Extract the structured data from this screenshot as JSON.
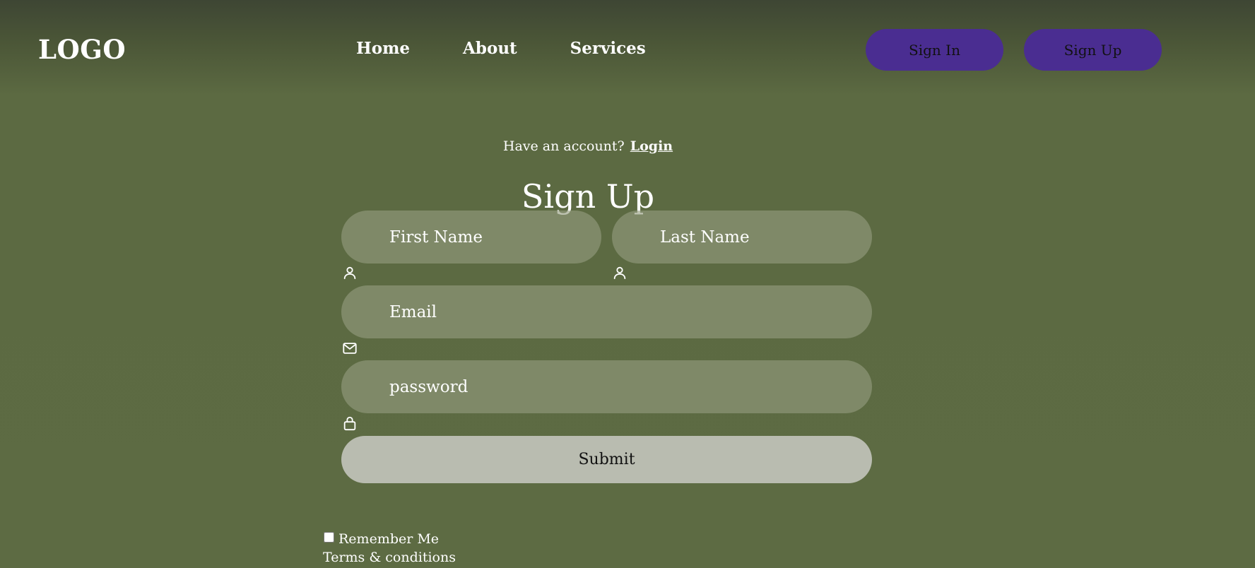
{
  "header": {
    "logo": "LOGO",
    "nav": [
      {
        "label": "Home"
      },
      {
        "label": "About"
      },
      {
        "label": "Services"
      }
    ],
    "sign_in_label": "Sign In",
    "sign_up_label": "Sign Up"
  },
  "form": {
    "have_account_text": "Have an account?",
    "login_link": "Login",
    "title": "Sign Up",
    "first_name_placeholder": "First Name",
    "last_name_placeholder": "Last Name",
    "email_placeholder": "Email",
    "password_placeholder": "password",
    "submit_label": "Submit",
    "remember_label": "Remember Me",
    "remember_checked": false,
    "terms_label": "Terms & conditions"
  },
  "icons": {
    "first_name": "user-icon",
    "last_name": "user-icon",
    "email": "envelope-icon",
    "password": "lock-icon"
  },
  "colors": {
    "background": "#5d6b43",
    "auth_button": "#4a2d91",
    "input_fill": "#7a8465",
    "submit_fill": "#b9bcb0"
  }
}
